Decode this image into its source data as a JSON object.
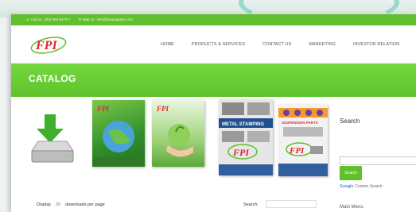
{
  "infobar": {
    "phone": "Call us : (02) 953-8373-7",
    "email": "Mail us : info@fpiautoparts.com"
  },
  "brand": {
    "logo_text": "FPI"
  },
  "nav": {
    "items": [
      "HOME",
      "PRODUCTS & SERVICES",
      "CONTACT US",
      "MARKETING",
      "INVESTOR RELATION"
    ]
  },
  "banner": {
    "title": "CATALOG"
  },
  "catalog": {
    "covers": [
      {
        "heading": "FPI",
        "name": "catalog-globe-cover"
      },
      {
        "heading": "FPI",
        "name": "catalog-hands-cover"
      },
      {
        "heading": "METAL STAMPING",
        "name": "catalog-metal-stamping-cover"
      },
      {
        "heading": "SUSPENSION PARTS",
        "name": "catalog-suspension-cover"
      }
    ],
    "icons": {
      "download": "download-drive-icon"
    }
  },
  "sidebar": {
    "search_title": "Search",
    "search_button": "Search",
    "google_label": "Google",
    "google_sub": "Custom Search",
    "main_menu": "Main Menu"
  },
  "list_controls": {
    "display_label": "Display",
    "display_value": "20",
    "per_page_label": "downloads per page",
    "search_label": "Search:"
  },
  "colors": {
    "brand_green": "#5fbf2c",
    "banner_green": "#6fd23a",
    "logo_red": "#e3262a"
  }
}
